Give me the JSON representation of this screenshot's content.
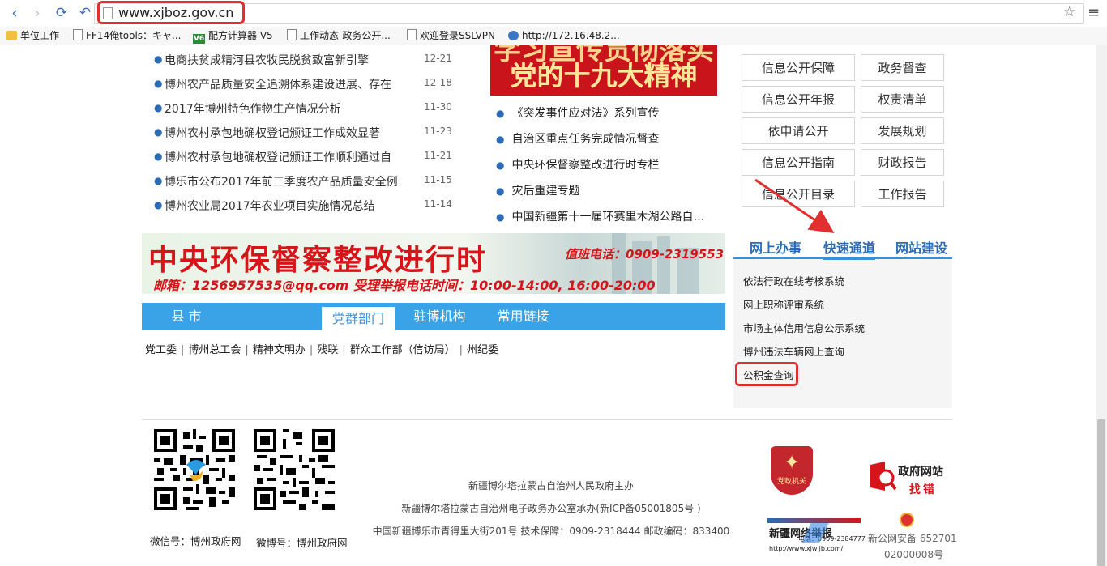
{
  "browser": {
    "url": "www.xjboz.gov.cn",
    "bookmarks": [
      "单位工作",
      "FF14俺tools：キャ...",
      "配方计算器 V5",
      "工作动态-政务公开...",
      "欢迎登录SSLVPN",
      "http://172.16.48.2..."
    ],
    "v6_label": "V6"
  },
  "news": [
    {
      "title": "电商扶贫成精河县农牧民脱贫致富新引擎",
      "date": "12-21"
    },
    {
      "title": "博州农产品质量安全追溯体系建设进展、存在",
      "date": "12-18"
    },
    {
      "title": "2017年博州特色作物生产情况分析",
      "date": "11-30"
    },
    {
      "title": "博州农村承包地确权登记颁证工作成效显著",
      "date": "11-23"
    },
    {
      "title": "博州农村承包地确权登记颁证工作顺利通过自",
      "date": "11-21"
    },
    {
      "title": "博乐市公布2017年前三季度农产品质量安全例",
      "date": "11-15"
    },
    {
      "title": "博州农业局2017年农业项目实施情况总结",
      "date": "11-14"
    }
  ],
  "red_banner": {
    "line1": "学习宣传贯彻落实",
    "line2": "党的十九大精神"
  },
  "middle_list": [
    "《突发事件应对法》系列宣传",
    "自治区重点任务完成情况督查",
    "中央环保督察整改进行时专栏",
    "灾后重建专题",
    "中国新疆第十一届环赛里木湖公路自…"
  ],
  "grid_buttons": [
    [
      "信息公开保障",
      "政务督查"
    ],
    [
      "信息公开年报",
      "权责清单"
    ],
    [
      "依申请公开",
      "发展规划"
    ],
    [
      "信息公开指南",
      "财政报告"
    ],
    [
      "信息公开目录",
      "工作报告"
    ]
  ],
  "env_banner": {
    "title": "中央环保督察整改进行时",
    "tel": "值班电话：0909-2319553",
    "mail": "邮箱：1256957535@qq.com  受理举报电话时间：10:00-14:00, 16:00-20:00"
  },
  "tabs": [
    "县 市",
    "党群部门",
    "驻博机构",
    "常用链接"
  ],
  "dept_links": [
    "党工委",
    "博州总工会",
    "精神文明办",
    "残联",
    "群众工作部（信访局）",
    "州纪委"
  ],
  "right_tabs": [
    "网上办事",
    "快速通道",
    "网站建设"
  ],
  "right_links": [
    "依法行政在线考核系统",
    "网上职称评审系统",
    "市场主体信用信息公示系统",
    "博州违法车辆网上查询",
    "公积金查询"
  ],
  "footer": {
    "qr_captions": [
      "微信号：博州政府网",
      "微博号：博州政府网"
    ],
    "lines": [
      "新疆博尔塔拉蒙古自治州人民政府主办",
      "新疆博尔塔拉蒙古自治州电子政务办公室承办(新ICP备05001805号 )",
      "中国新疆博乐市青得里大街201号    技术保障：0909-2318444    邮政编码：833400"
    ],
    "badge_text": "党政机关",
    "zhaocuo_1": "政府网站",
    "zhaocuo_2": "找错",
    "xj_title": "新疆网络举报",
    "xj_tel": "电话：0909-2384777",
    "xj_url": "http://www.xjwljb.com/",
    "police_1": "新公网安备 652701",
    "police_2": "02000008号"
  }
}
